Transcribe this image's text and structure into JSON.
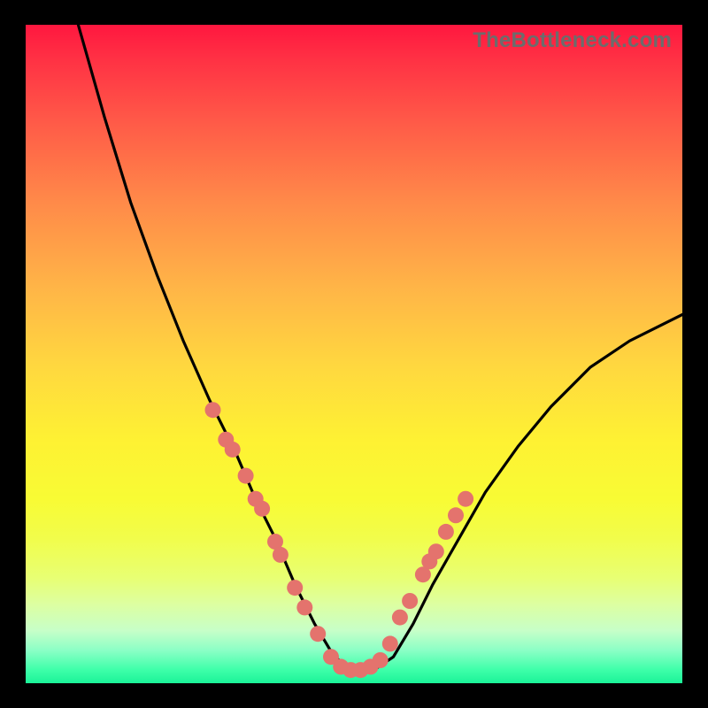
{
  "watermark": "TheBottleneck.com",
  "chart_data": {
    "type": "line",
    "title": "",
    "xlabel": "",
    "ylabel": "",
    "xlim": [
      0,
      100
    ],
    "ylim": [
      0,
      100
    ],
    "grid": false,
    "description": "V-shaped bottleneck curve on rainbow gradient. Left branch descends steeply from top-left, both branches meet in a flat trough near the bottom around x≈45–55, right branch rises toward the right edge about 55% up. Pink dots mark sample points clustered on the lower parts of both branches and across the trough.",
    "series": [
      {
        "name": "curve",
        "x": [
          8,
          12,
          16,
          20,
          24,
          28,
          32,
          35,
          38,
          41,
          44,
          47,
          50,
          53,
          56,
          59,
          62,
          66,
          70,
          75,
          80,
          86,
          92,
          100
        ],
        "y": [
          100,
          86,
          73,
          62,
          52,
          43,
          35,
          28,
          22,
          15,
          9,
          4,
          2,
          2,
          4,
          9,
          15,
          22,
          29,
          36,
          42,
          48,
          52,
          56
        ]
      },
      {
        "name": "dots",
        "x": [
          28.5,
          30.5,
          31.5,
          33.5,
          35.0,
          36.0,
          38.0,
          38.8,
          41.0,
          42.5,
          44.5,
          46.5,
          48.0,
          49.5,
          51.0,
          52.5,
          54.0,
          55.5,
          57.0,
          58.5,
          60.5,
          61.5,
          62.5,
          64.0,
          65.5,
          67.0
        ],
        "y": [
          41.5,
          37.0,
          35.5,
          31.5,
          28.0,
          26.5,
          21.5,
          19.5,
          14.5,
          11.5,
          7.5,
          4.0,
          2.5,
          2.0,
          2.0,
          2.5,
          3.5,
          6.0,
          10.0,
          12.5,
          16.5,
          18.5,
          20.0,
          23.0,
          25.5,
          28.0
        ]
      }
    ],
    "colors": {
      "curve_stroke": "#000000",
      "dot_fill": "#e4736d"
    }
  }
}
